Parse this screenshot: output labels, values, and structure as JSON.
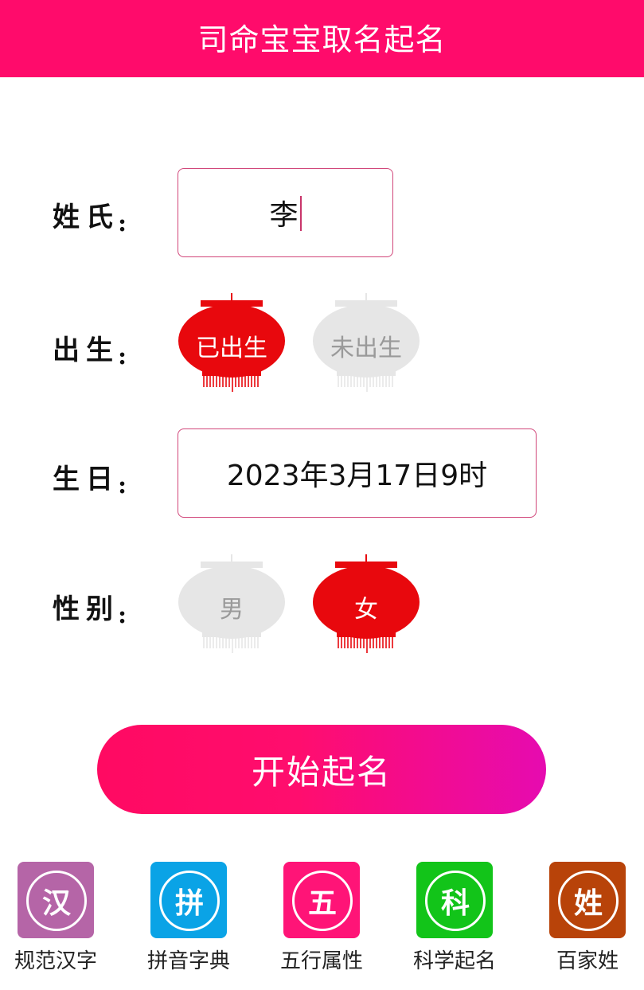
{
  "header": {
    "title": "司命宝宝取名起名",
    "color": "#ff0b6b"
  },
  "form": {
    "surname": {
      "label": "姓氏",
      "colon": ":",
      "value": "李"
    },
    "birth_status": {
      "label": "出生",
      "colon": ":",
      "options": [
        "已出生",
        "未出生"
      ],
      "selected": "已出生"
    },
    "birthday": {
      "label": "生日",
      "colon": ":",
      "value": "2023年3月17日9时"
    },
    "gender": {
      "label": "性别",
      "colon": ":",
      "options": [
        "男",
        "女"
      ],
      "selected": "女"
    }
  },
  "start_button": {
    "label": "开始起名"
  },
  "tools": [
    {
      "glyph": "汉",
      "label": "规范汉字",
      "color": "#b565a7",
      "icon": "han-character-icon"
    },
    {
      "glyph": "拼",
      "label": "拼音字典",
      "color": "#0aa3e6",
      "icon": "pinyin-icon"
    },
    {
      "glyph": "五",
      "label": "五行属性",
      "color": "#ff1477",
      "icon": "five-elements-icon"
    },
    {
      "glyph": "科",
      "label": "科学起名",
      "color": "#12c419",
      "icon": "science-icon"
    },
    {
      "glyph": "姓",
      "label": "百家姓",
      "color": "#b84309",
      "icon": "surname-icon"
    }
  ],
  "colors": {
    "lantern_on": "#e8080d",
    "lantern_off": "#e6e6e6",
    "input_border": "#d1467a"
  }
}
